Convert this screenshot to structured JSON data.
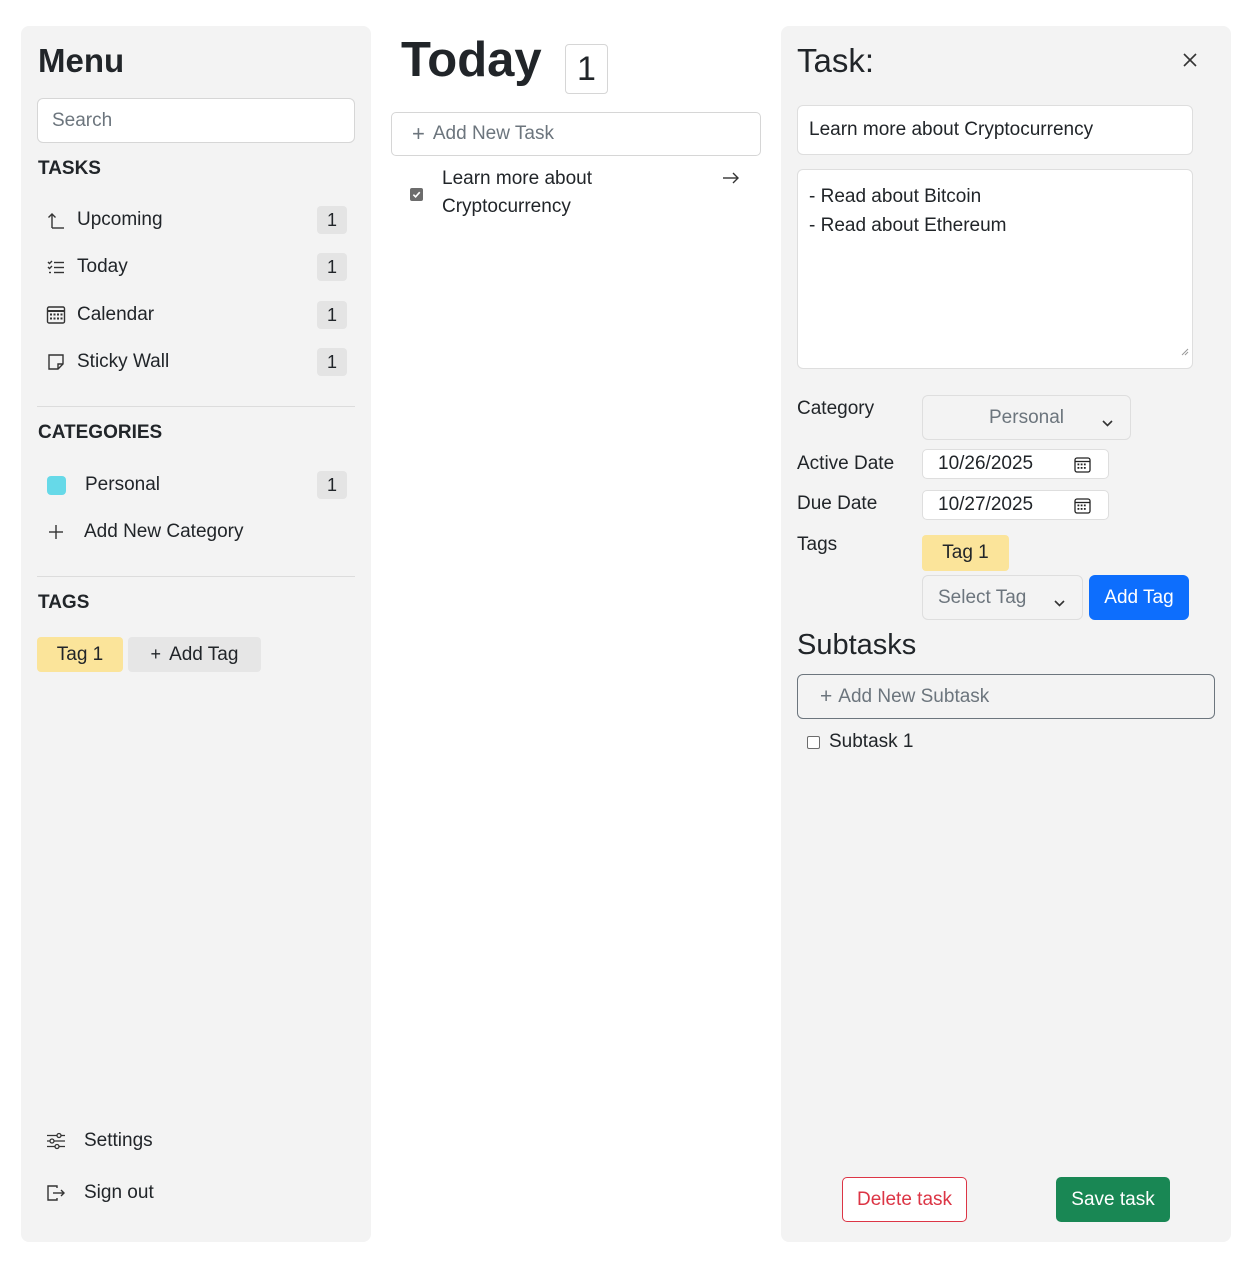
{
  "sidebar": {
    "title": "Menu",
    "search_placeholder": "Search",
    "tasks_heading": "TASKS",
    "items": [
      {
        "label": "Upcoming",
        "count": "1",
        "icon": "upcoming-icon"
      },
      {
        "label": "Today",
        "count": "1",
        "icon": "list-icon"
      },
      {
        "label": "Calendar",
        "count": "1",
        "icon": "calendar-icon"
      },
      {
        "label": "Sticky Wall",
        "count": "1",
        "icon": "sticky-note-icon"
      }
    ],
    "categories_heading": "CATEGORIES",
    "categories": [
      {
        "label": "Personal",
        "count": "1",
        "color": "#66d9e8"
      }
    ],
    "add_category_label": "Add New Category",
    "tags_heading": "TAGS",
    "tags": [
      {
        "label": "Tag 1",
        "color": "#fbe49a"
      }
    ],
    "add_tag_label": "Add Tag",
    "settings_label": "Settings",
    "signout_label": "Sign out"
  },
  "main": {
    "title": "Today",
    "count": "1",
    "add_task_label": "Add New Task",
    "tasks": [
      {
        "text": "Learn more about Cryptocurrency",
        "checked": true
      }
    ]
  },
  "panel": {
    "title": "Task:",
    "task_title_value": "Learn more about Cryptocurrency",
    "description_lines": [
      "- Read about Bitcoin",
      "- Read about Ethereum"
    ],
    "category_label": "Category",
    "category_value": "Personal",
    "active_date_label": "Active Date",
    "active_date_value": "10/26/2025",
    "due_date_label": "Due Date",
    "due_date_value": "10/27/2025",
    "tags_label": "Tags",
    "tag_value": "Tag 1",
    "select_tag_placeholder": "Select Tag",
    "add_tag_button": "Add Tag",
    "subtasks_title": "Subtasks",
    "add_subtask_label": "Add New Subtask",
    "subtasks": [
      {
        "label": "Subtask 1",
        "checked": false
      }
    ],
    "delete_label": "Delete task",
    "save_label": "Save task"
  },
  "colors": {
    "accent_blue": "#0d6efd",
    "save_green": "#198754",
    "delete_red": "#dc3545",
    "tag_yellow": "#fbe49a",
    "panel_bg": "#f3f3f3"
  }
}
